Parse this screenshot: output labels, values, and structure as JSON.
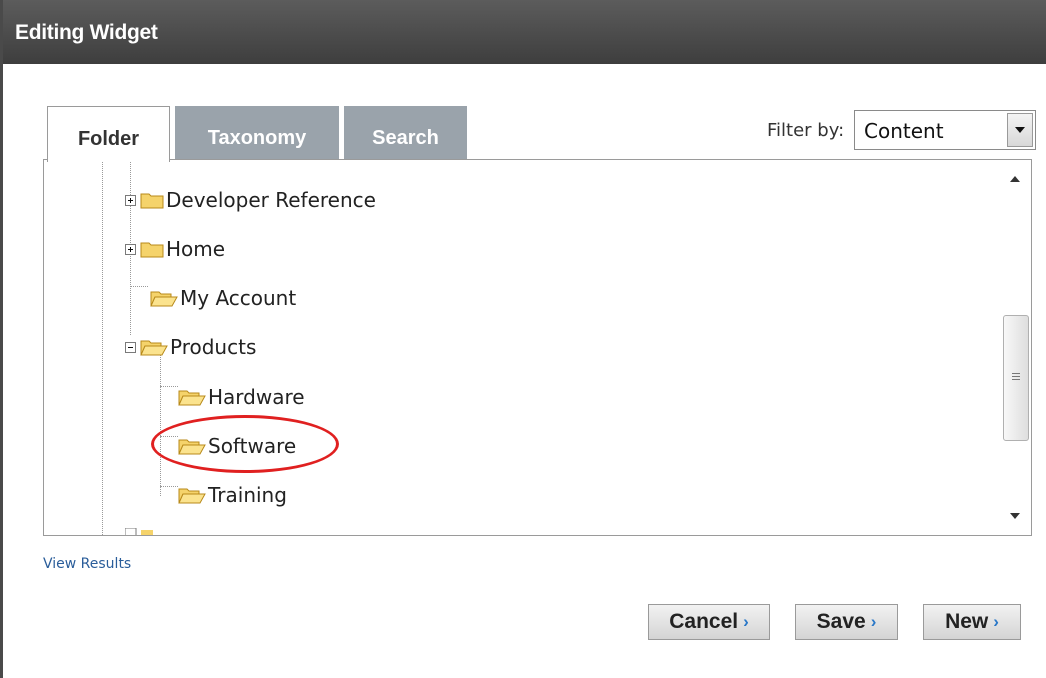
{
  "window": {
    "title": "Editing Widget"
  },
  "tabs": [
    {
      "label": "Folder",
      "active": true
    },
    {
      "label": "Taxonomy",
      "active": false
    },
    {
      "label": "Search",
      "active": false
    }
  ],
  "filter": {
    "label": "Filter by:",
    "value": "Content"
  },
  "tree": {
    "nodes": [
      {
        "label": "Developer Reference",
        "expander": "plus",
        "folder": "closed"
      },
      {
        "label": "Home",
        "expander": "plus",
        "folder": "closed"
      },
      {
        "label": "My Account",
        "expander": "none",
        "folder": "open"
      },
      {
        "label": "Products",
        "expander": "minus",
        "folder": "open"
      },
      {
        "label": "Hardware",
        "expander": "none",
        "folder": "open"
      },
      {
        "label": "Software",
        "expander": "none",
        "folder": "open",
        "highlighted": true
      },
      {
        "label": "Training",
        "expander": "none",
        "folder": "open"
      }
    ]
  },
  "links": {
    "view_results": "View Results"
  },
  "buttons": {
    "cancel": "Cancel",
    "save": "Save",
    "new": "New",
    "chevron": "›"
  },
  "colors": {
    "titlebar": "#4a4a4a",
    "inactive_tab": "#9aa3ab",
    "link": "#2a5d9a",
    "highlight": "#e02020",
    "folder": "#f2c94c"
  }
}
